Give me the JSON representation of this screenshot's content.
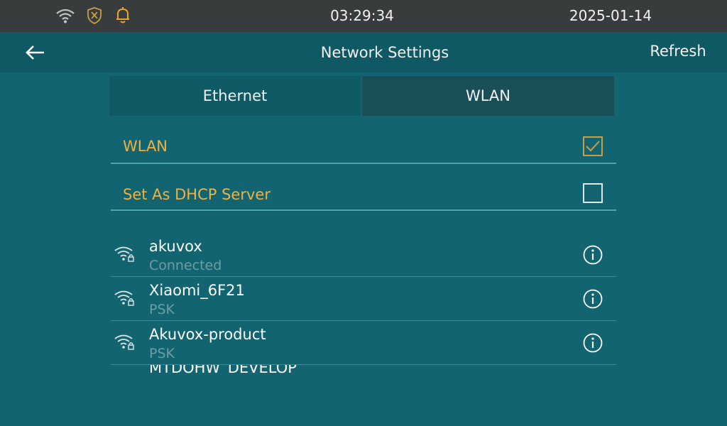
{
  "status_bar": {
    "time": "03:29:34",
    "date": "2025-01-14",
    "icons": [
      "wifi-icon",
      "shield-icon",
      "bell-icon"
    ],
    "colors": {
      "background": "#393c3d",
      "shield": "#c89f44",
      "bell": "#e8a52a"
    }
  },
  "header": {
    "title": "Network Settings",
    "refresh_label": "Refresh",
    "back_icon": "arrow-left-icon"
  },
  "tabs": [
    {
      "label": "Ethernet",
      "active": false
    },
    {
      "label": "WLAN",
      "active": true
    }
  ],
  "settings": [
    {
      "label": "WLAN",
      "checked": true
    },
    {
      "label": "Set As DHCP Server",
      "checked": false
    }
  ],
  "networks": [
    {
      "name": "akuvox",
      "status": "Connected",
      "icon": "wifi-lock-icon"
    },
    {
      "name": "Xiaomi_6F21",
      "status": "PSK",
      "icon": "wifi-lock-icon"
    },
    {
      "name": "Akuvox-product",
      "status": "PSK",
      "icon": "wifi-lock-icon"
    }
  ],
  "partial_network": {
    "name": "MTDOHW_DEVELOP"
  },
  "colors": {
    "background": "#126570",
    "accent_text": "#e9b24a",
    "secondary_text": "#6c9da3",
    "divider": "#4aa7ad"
  }
}
